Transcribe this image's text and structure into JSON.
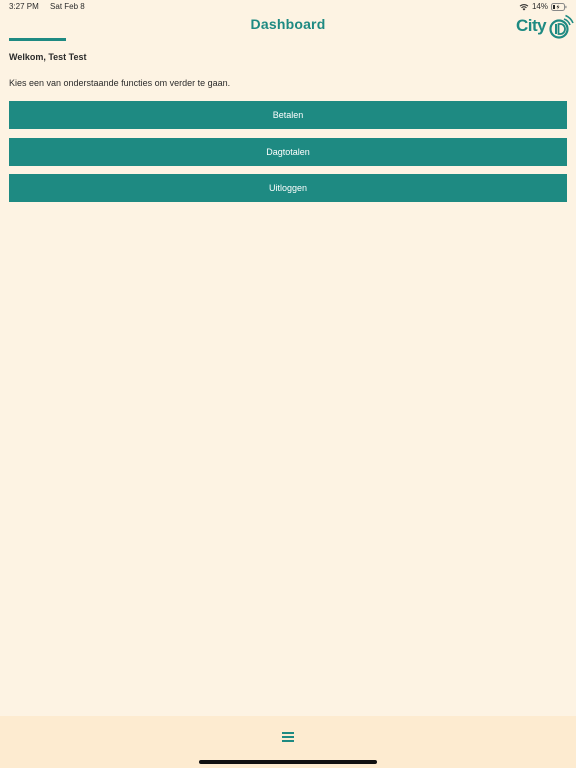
{
  "status_bar": {
    "time": "3:27 PM",
    "date": "Sat Feb 8",
    "battery": "14%"
  },
  "header": {
    "title": "Dashboard",
    "logo_text": "City"
  },
  "main": {
    "welcome": "Welkom, Test Test",
    "instruction": "Kies een van onderstaande functies om verder te gaan.",
    "buttons": [
      "Betalen",
      "Dagtotalen",
      "Uitloggen"
    ]
  },
  "colors": {
    "accent": "#1e8a82",
    "background": "#fdf3e3",
    "bottom_bar": "#fdebd0"
  },
  "icons": {
    "wifi": "wifi-icon",
    "battery": "battery-icon",
    "menu": "hamburger-menu-icon"
  }
}
